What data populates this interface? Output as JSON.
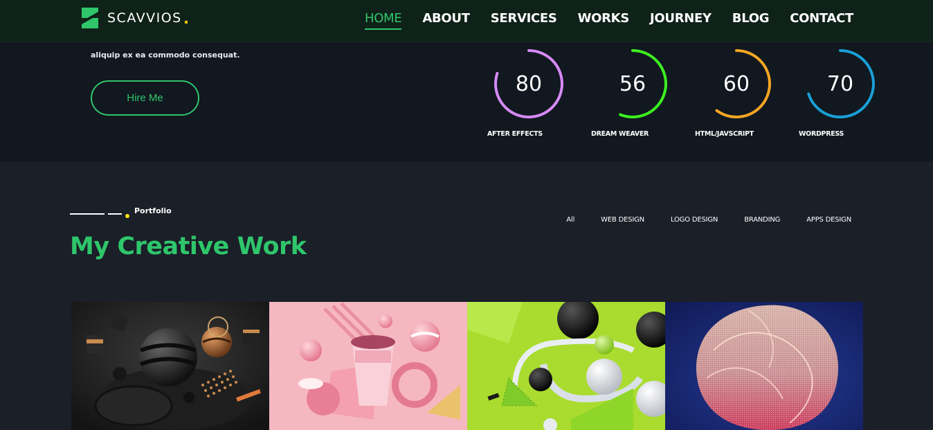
{
  "brand": {
    "name": "SCAVVIOS",
    "dot_color": "#f5c518",
    "mark_color": "#2fc66b"
  },
  "nav": {
    "items": [
      {
        "label": "HOME",
        "active": true
      },
      {
        "label": "ABOUT",
        "active": false
      },
      {
        "label": "SERVICES",
        "active": false
      },
      {
        "label": "WORKS",
        "active": false
      },
      {
        "label": "JOURNEY",
        "active": false
      },
      {
        "label": "BLOG",
        "active": false
      },
      {
        "label": "CONTACT",
        "active": false
      }
    ]
  },
  "hero": {
    "text": "aliquip ex ea commodo consequat.",
    "hire_button": "Hire Me"
  },
  "skills": [
    {
      "value": "80",
      "label": "AFTER EFFECTS",
      "color": "#d68af5",
      "percent": 80
    },
    {
      "value": "56",
      "label": "DREAM WEAVER",
      "color": "#3cf01f",
      "percent": 56
    },
    {
      "value": "60",
      "label": "HTML/JAVSCRIPT",
      "color": "#f5a623",
      "percent": 60
    },
    {
      "value": "70",
      "label": "WORDPRESS",
      "color": "#1a9fd6",
      "percent": 70
    }
  ],
  "portfolio": {
    "eyebrow": "Portfolio",
    "title": "My Creative Work",
    "filters": [
      "All",
      "WEB DESIGN",
      "LOGO DESIGN",
      "BRANDING",
      "APPS DESIGN"
    ]
  },
  "colors": {
    "accent": "#2fc66b",
    "bg": "#1a1f28",
    "hero_bg": "#111820",
    "header_bg": "#0f2219"
  }
}
